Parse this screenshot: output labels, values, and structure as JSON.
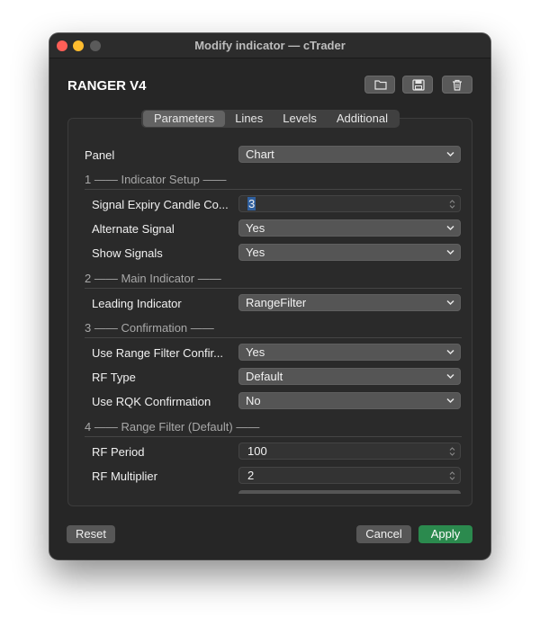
{
  "window": {
    "title": "Modify indicator — cTrader"
  },
  "header": {
    "indicator_name": "RANGER V4",
    "tools": [
      {
        "icon": "folder-icon"
      },
      {
        "icon": "save-icon"
      },
      {
        "icon": "trash-icon"
      }
    ]
  },
  "tabs": [
    {
      "label": "Parameters",
      "active": true
    },
    {
      "label": "Lines",
      "active": false
    },
    {
      "label": "Levels",
      "active": false
    },
    {
      "label": "Additional",
      "active": false
    }
  ],
  "panel": {
    "label": "Panel",
    "value": "Chart"
  },
  "sections": [
    {
      "title": "1 —— Indicator Setup ——"
    },
    {
      "title": "2 —— Main Indicator ——"
    },
    {
      "title": "3 —— Confirmation ——"
    },
    {
      "title": "4 —— Range Filter (Default) ——"
    }
  ],
  "fields": [
    {
      "label": "Signal Expiry Candle Co...",
      "value": "3",
      "type": "number"
    },
    {
      "label": "Alternate Signal",
      "value": "Yes",
      "type": "select"
    },
    {
      "label": "Show Signals",
      "value": "Yes",
      "type": "select"
    },
    {
      "label": "Leading Indicator",
      "value": "RangeFilter",
      "type": "select"
    },
    {
      "label": "Use Range Filter Confir...",
      "value": "Yes",
      "type": "select"
    },
    {
      "label": "RF Type",
      "value": "Default",
      "type": "select"
    },
    {
      "label": "Use RQK Confirmation",
      "value": "No",
      "type": "select"
    },
    {
      "label": "RF Period",
      "value": "100",
      "type": "number"
    },
    {
      "label": "RF Multiplier",
      "value": "2",
      "type": "number"
    }
  ],
  "footer": {
    "reset_label": "Reset",
    "cancel_label": "Cancel",
    "apply_label": "Apply"
  },
  "colors": {
    "apply_button": "#2b8a4e",
    "window_bg": "#262626",
    "control_bg": "#555555"
  }
}
